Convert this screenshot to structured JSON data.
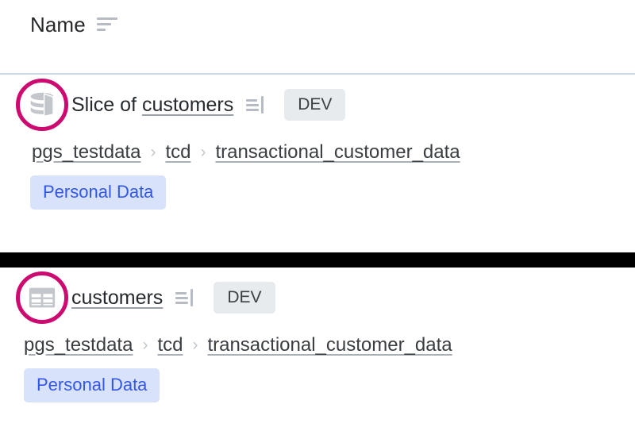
{
  "header": {
    "column_label": "Name",
    "sort_icon": "sort-icon"
  },
  "colors": {
    "highlight_ring": "#cc0a6f",
    "tag_background": "#d9e2fb",
    "tag_text": "#3256e8",
    "env_badge_background": "#e7ebee",
    "divider": "#ccd6e0",
    "separator_band": "#000000",
    "icon_gray": "#c3c6cb"
  },
  "results": [
    {
      "icon": "database-slice-icon",
      "title_prefix": "Slice of ",
      "title_link": "customers",
      "columns_icon": "columns-list-icon",
      "env_badge": "DEV",
      "breadcrumb": [
        "pgs_testdata",
        "tcd",
        "transactional_customer_data"
      ],
      "breadcrumb_separator": "›",
      "tags": [
        "Personal Data"
      ]
    },
    {
      "icon": "table-icon",
      "title_prefix": "",
      "title_link": "customers",
      "columns_icon": "columns-list-icon",
      "env_badge": "DEV",
      "breadcrumb": [
        "pgs_testdata",
        "tcd",
        "transactional_customer_data"
      ],
      "breadcrumb_separator": "›",
      "tags": [
        "Personal Data"
      ]
    }
  ]
}
